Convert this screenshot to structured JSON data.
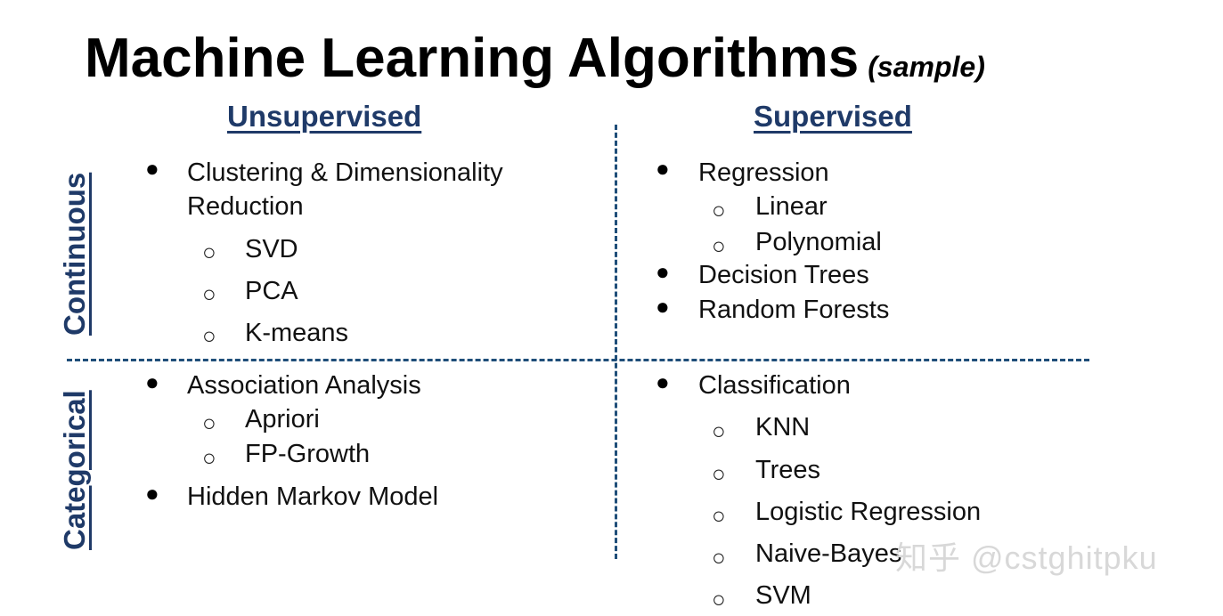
{
  "title": {
    "main": "Machine Learning Algorithms",
    "sample": "(sample)"
  },
  "columns": {
    "left": "Unsupervised",
    "right": "Supervised"
  },
  "rows": {
    "top": "Continuous",
    "bottom": "Categorical"
  },
  "quadrants": {
    "unsup_cont": {
      "bullet1_line1": "Clustering & Dimensionality",
      "bullet1_line2": "Reduction",
      "sub": [
        "SVD",
        "PCA",
        "K-means"
      ]
    },
    "sup_cont": {
      "bullet1": "Regression",
      "sub": [
        "Linear",
        "Polynomial"
      ],
      "bullet2": "Decision Trees",
      "bullet3": "Random Forests"
    },
    "unsup_cat": {
      "bullet1": "Association Analysis",
      "sub": [
        "Apriori",
        "FP-Growth"
      ],
      "bullet2": "Hidden Markov Model"
    },
    "sup_cat": {
      "bullet1": "Classification",
      "sub": [
        "KNN",
        "Trees",
        "Logistic Regression",
        "Naive-Bayes",
        "SVM"
      ]
    }
  },
  "watermark": "知乎 @cstghitpku",
  "colors": {
    "heading": "#1f3a68",
    "divider": "#1f4e79"
  }
}
